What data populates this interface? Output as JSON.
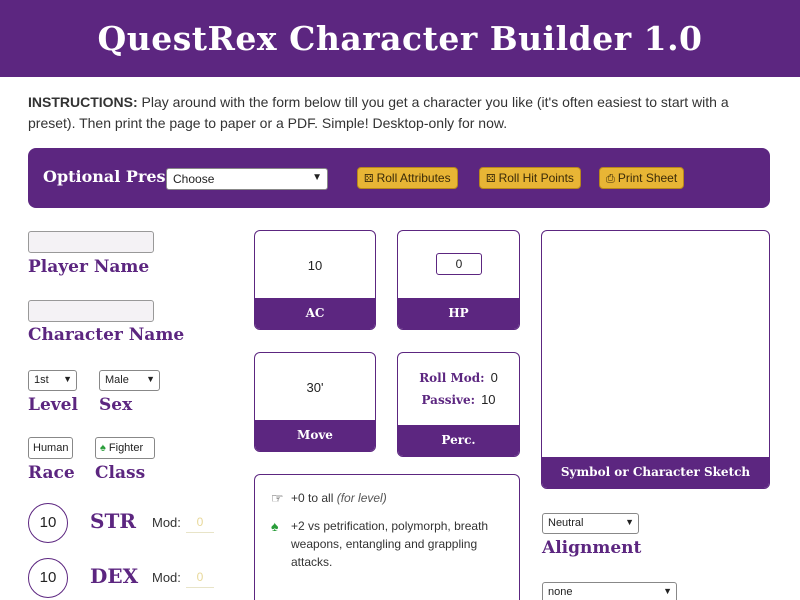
{
  "header": {
    "title": "QuestRex Character Builder 1.0"
  },
  "instructions": {
    "lead": "INSTRUCTIONS:",
    "text": " Play around with the form below till you get a character you like (it's often easiest to start with a preset). Then print the page to paper or a PDF. Simple! Desktop-only for now."
  },
  "preset": {
    "label": "Optional Preset :",
    "selected": "Choose",
    "buttons": {
      "roll_attributes": "Roll Attributes",
      "roll_hit_points": "Roll Hit Points",
      "print_sheet": "Print Sheet"
    }
  },
  "fields": {
    "player_name_label": "Player Name",
    "character_name_label": "Character Name",
    "level": {
      "value": "1st",
      "label": "Level"
    },
    "sex": {
      "value": "Male",
      "label": "Sex"
    },
    "race": {
      "value": "Human",
      "label": "Race"
    },
    "class": {
      "value": "Fighter",
      "label": "Class"
    }
  },
  "attributes": [
    {
      "name": "STR",
      "score": "10",
      "mod_label": "Mod:",
      "mod": "0"
    },
    {
      "name": "DEX",
      "score": "10",
      "mod_label": "Mod:",
      "mod": "0"
    }
  ],
  "stats": {
    "ac": {
      "value": "10",
      "label": "AC"
    },
    "hp": {
      "value": "0",
      "label": "HP"
    },
    "move": {
      "value": "30'",
      "label": "Move"
    },
    "perc": {
      "roll_mod_label": "Roll Mod:",
      "roll_mod": "0",
      "passive_label": "Passive:",
      "passive": "10",
      "label": "Perc."
    }
  },
  "abilities": [
    {
      "icon": "hand-point-right-icon",
      "text": "+0 to all ",
      "note": "(for level)"
    },
    {
      "icon": "spade-icon",
      "text": "+2 vs petrification, polymorph, breath weapons, entangling and grappling attacks.",
      "note": ""
    }
  ],
  "sketch": {
    "label": "Symbol or Character Sketch"
  },
  "alignment": {
    "value": "Neutral",
    "label": "Alignment"
  },
  "extra_select": {
    "value": "none"
  },
  "colors": {
    "brand_purple": "#5c2680",
    "button_yellow": "#e8b535",
    "class_green": "#2a9d3a"
  }
}
